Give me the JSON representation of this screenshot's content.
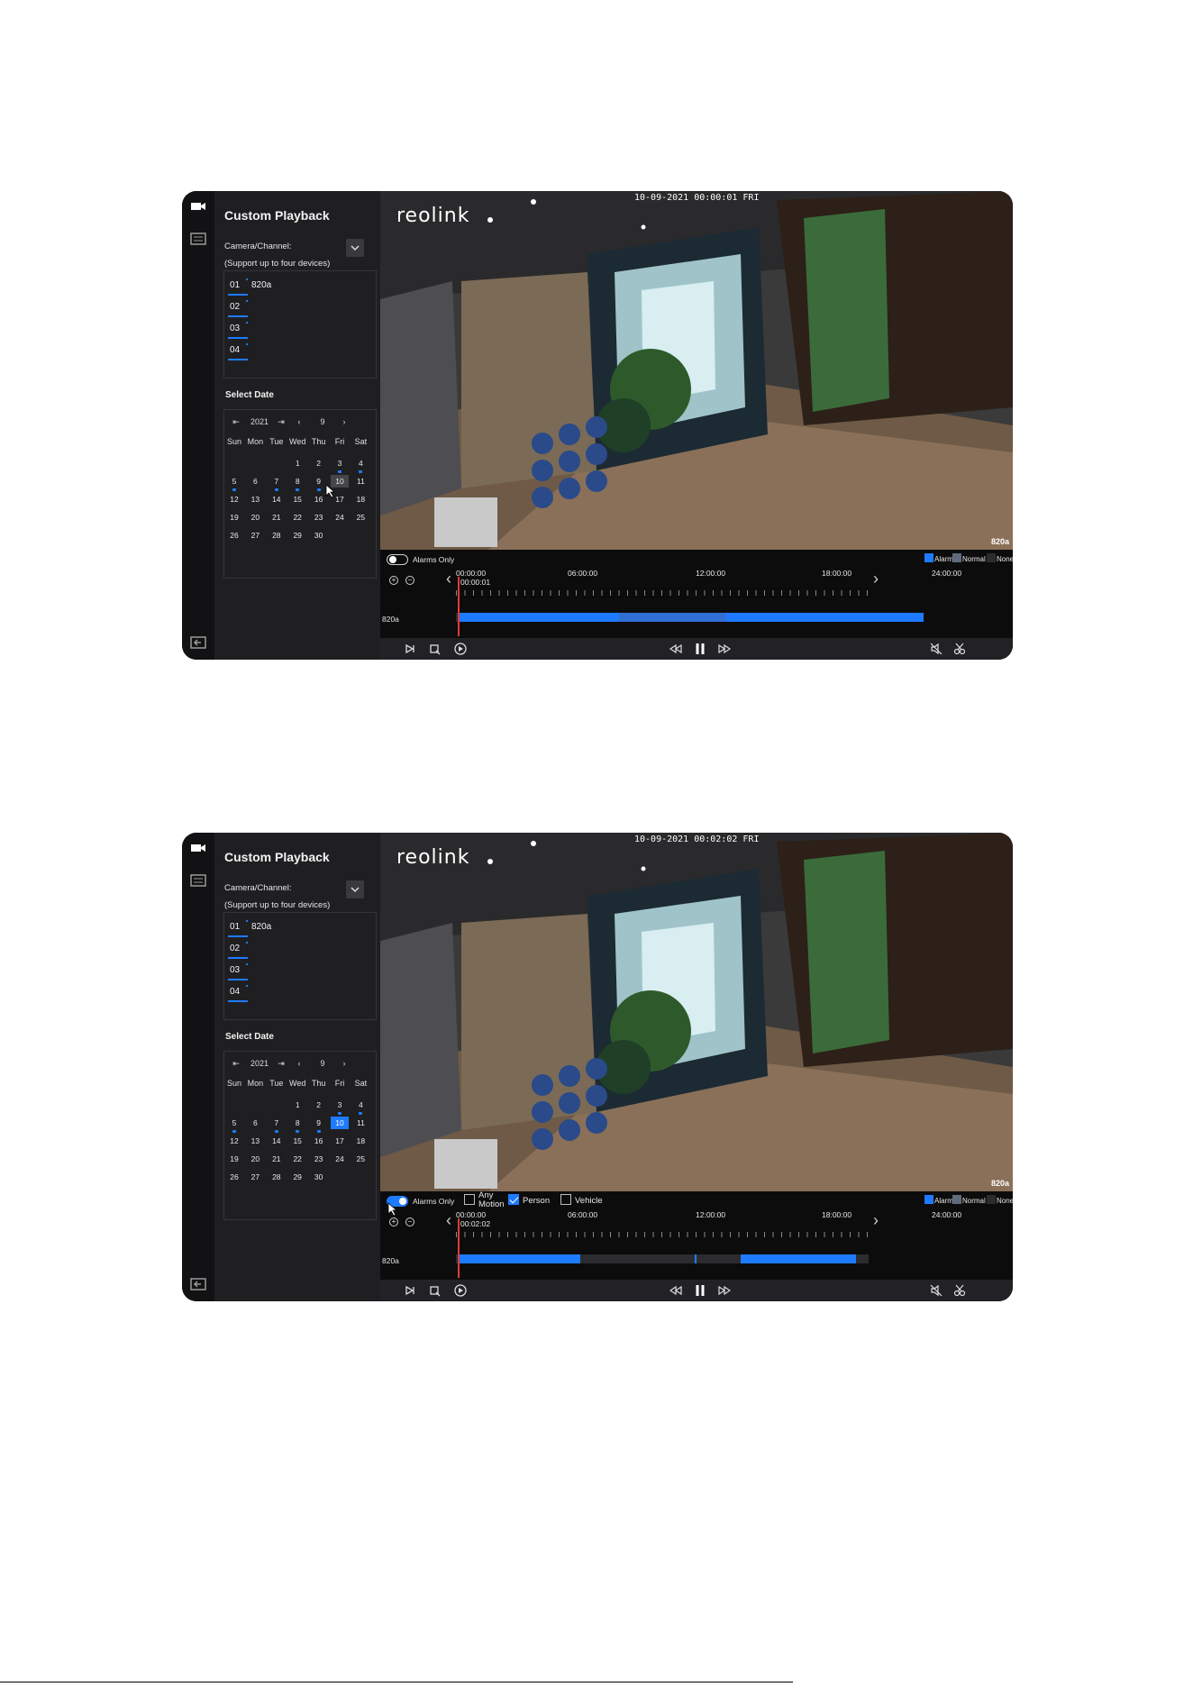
{
  "shots": [
    {
      "panel_title": "Custom Playback",
      "camera_channel_label": "Camera/Channel:",
      "support_note": "(Support up to four devices)",
      "channels": [
        {
          "num": "01",
          "name": "820a"
        },
        {
          "num": "02",
          "name": ""
        },
        {
          "num": "03",
          "name": ""
        },
        {
          "num": "04",
          "name": ""
        }
      ],
      "select_date_label": "Select Date",
      "calendar": {
        "year": "2021",
        "month": "9",
        "weekdays": [
          "Sun",
          "Mon",
          "Tue",
          "Wed",
          "Thu",
          "Fri",
          "Sat"
        ],
        "selected_day": "10"
      },
      "logo": "reolink",
      "timestamp": "10-09-2021 00:00:01 FRI",
      "camera_label": "820a",
      "alarms_only_label": "Alarms Only",
      "alarms_only_on": false,
      "legend": {
        "alarm": "Alarm",
        "normal": "Normal",
        "none": "None"
      },
      "timeline_labels": [
        "00:00:00",
        "06:00:00",
        "12:00:00",
        "18:00:00",
        "24:00:00"
      ],
      "current_time": "00:00:01",
      "track_label": "820a"
    },
    {
      "panel_title": "Custom Playback",
      "camera_channel_label": "Camera/Channel:",
      "support_note": "(Support up to four devices)",
      "channels": [
        {
          "num": "01",
          "name": "820a"
        },
        {
          "num": "02",
          "name": ""
        },
        {
          "num": "03",
          "name": ""
        },
        {
          "num": "04",
          "name": ""
        }
      ],
      "select_date_label": "Select Date",
      "calendar": {
        "year": "2021",
        "month": "9",
        "weekdays": [
          "Sun",
          "Mon",
          "Tue",
          "Wed",
          "Thu",
          "Fri",
          "Sat"
        ],
        "selected_day": "10"
      },
      "logo": "reolink",
      "timestamp": "10-09-2021 00:02:02 FRI",
      "camera_label": "820a",
      "alarms_only_label": "Alarms Only",
      "alarms_only_on": true,
      "filters": [
        {
          "label": "Any Motion",
          "checked": false
        },
        {
          "label": "Person",
          "checked": true
        },
        {
          "label": "Vehicle",
          "checked": false
        }
      ],
      "legend": {
        "alarm": "Alarm",
        "normal": "Normal",
        "none": "None"
      },
      "timeline_labels": [
        "00:00:00",
        "06:00:00",
        "12:00:00",
        "18:00:00",
        "24:00:00"
      ],
      "current_time": "00:02:02",
      "track_label": "820a"
    }
  ],
  "colors": {
    "accent": "#1e7bff",
    "playhead": "#e33a35",
    "normal": "#5f6b7d"
  },
  "icons": [
    "camera-icon",
    "list-icon",
    "exit-icon",
    "chevron-down-icon",
    "zoom-in-icon",
    "zoom-out-icon",
    "skip-end-icon",
    "snapshot-icon",
    "speed-icon",
    "rewind-icon",
    "pause-icon",
    "fast-forward-icon",
    "mute-icon",
    "clip-icon",
    "cursor-icon"
  ]
}
